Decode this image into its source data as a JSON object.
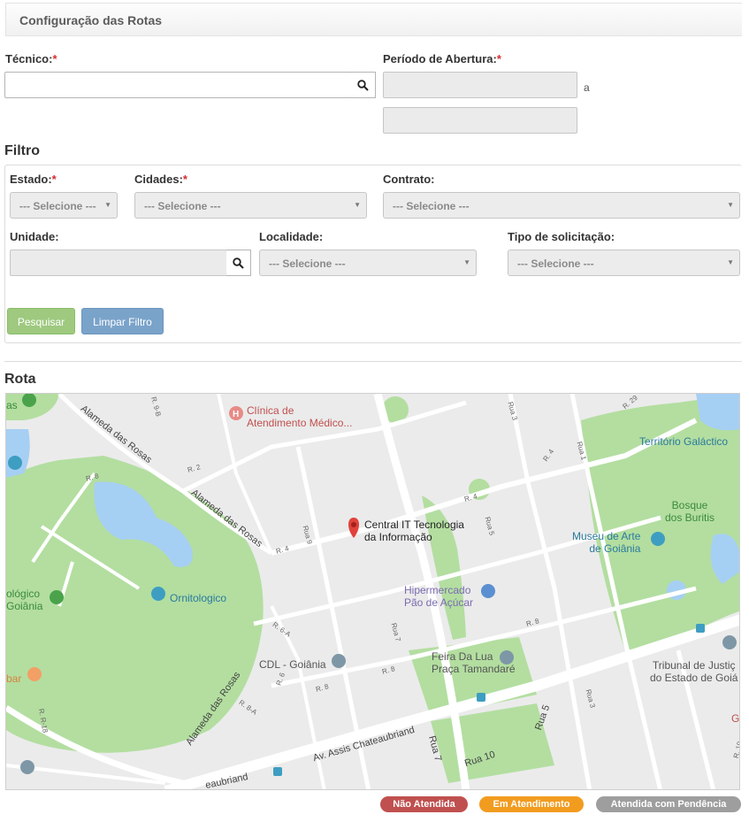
{
  "header": {
    "title": "Configuração das Rotas"
  },
  "form": {
    "tecnico_label": "Técnico:",
    "periodo_label": "Período de Abertura:",
    "periodo_sep": "a",
    "required_mark": "*"
  },
  "filter": {
    "title": "Filtro",
    "estado": {
      "label": "Estado:",
      "value": "--- Selecione ---"
    },
    "cidades": {
      "label": "Cidades:",
      "value": "--- Selecione ---"
    },
    "contrato": {
      "label": "Contrato:",
      "value": "--- Selecione ---"
    },
    "unidade": {
      "label": "Unidade:"
    },
    "localidade": {
      "label": "Localidade:",
      "value": "--- Selecione ---"
    },
    "tipo": {
      "label": "Tipo de solicitação:",
      "value": "--- Selecione ---"
    },
    "search_button": "Pesquisar",
    "clear_button": "Limpar Filtro"
  },
  "route": {
    "title": "Rota",
    "map_labels": {
      "clinica": "Clínica de\nAtendimento Médico...",
      "central": "Central IT Tecnologia\nda Informação",
      "territorio": "Território Galáctico",
      "bosque": "Bosque\ndos Buritis",
      "museu": "Museu de Arte\nde Goiânia",
      "hipermercado": "Hipermercado\nPão de Açúcar",
      "ornitologico": "Ornitologico",
      "zoo": "ológico\nGoiânia",
      "feira": "Feira Da Lua\nPraça Tamandaré",
      "cdl": "CDL - Goiânia",
      "tribunal": "Tribunal de Justiç\ndo Estado de Goiá",
      "bar": "bar",
      "as": "as",
      "g": "G"
    },
    "streets": {
      "alameda1": "Alameda das Rosas",
      "alameda2": "Alameda das Rosas",
      "alameda3": "Alameda das Rosas",
      "assis": "Av. Assis Chateaubriand",
      "assis2": "eaubriand",
      "r2": "R. 2",
      "r4a": "R. 4",
      "r4b": "R. 4",
      "r4c": "R. 4",
      "r9b": "R. 9-B",
      "r29": "R. 29",
      "r3a": "Rua 3",
      "r3b": "Rua 3",
      "r1": "Rua 1",
      "r9": "Rua 9",
      "r5": "Rua 5",
      "r5b": "Rua 5",
      "r7": "Rua 7",
      "r7b": "Rua 7",
      "r10": "Rua 10",
      "r8a": "R. 8",
      "r8b": "R. 8",
      "r8c": "R. 8",
      "r8d": "R. 8",
      "r6a": "R. 6-A",
      "r6": "R. 6",
      "r8aa": "R. 8-A",
      "r18": "R. R-18",
      "r19": "R. 19"
    },
    "colors": {
      "park": "#b3dea0",
      "water": "#a6cff4",
      "road": "#ffffff",
      "block": "#ebebeb"
    }
  },
  "legend": [
    {
      "label": "Não Atendida",
      "color": "#c0504f"
    },
    {
      "label": "Em Atendimento",
      "color": "#f29c1f"
    },
    {
      "label": "Atendida com Pendência",
      "color": "#9e9e9e"
    }
  ]
}
